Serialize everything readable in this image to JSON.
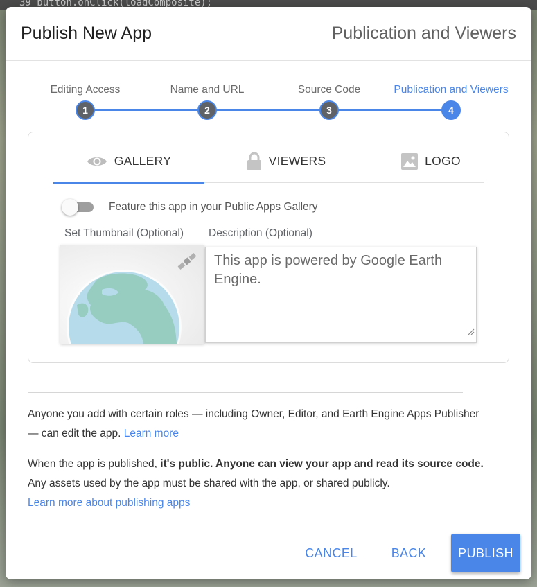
{
  "background": {
    "code_snippet": "39  button.onClick(loadComposite);"
  },
  "dialog": {
    "title": "Publish New App",
    "current_step_title": "Publication and Viewers"
  },
  "stepper": {
    "steps": [
      {
        "label": "Editing Access",
        "number": "1",
        "active": false
      },
      {
        "label": "Name and URL",
        "number": "2",
        "active": false
      },
      {
        "label": "Source Code",
        "number": "3",
        "active": false
      },
      {
        "label": "Publication and Viewers",
        "number": "4",
        "active": true
      }
    ]
  },
  "tabs": [
    {
      "label": "GALLERY",
      "icon": "eye-icon",
      "active": true
    },
    {
      "label": "VIEWERS",
      "icon": "lock-icon",
      "active": false
    },
    {
      "label": "LOGO",
      "icon": "image-icon",
      "active": false
    }
  ],
  "gallery": {
    "feature_toggle_label": "Feature this app in your Public Apps Gallery",
    "feature_toggle_on": false,
    "thumbnail_label": "Set Thumbnail (Optional)",
    "description_label": "Description (Optional)",
    "description_value": "This app is powered by Google Earth Engine."
  },
  "info": {
    "roles_text": "Anyone you add with certain roles — including Owner, Editor, and Earth Engine Apps Publisher — can edit the app.",
    "roles_link": "Learn more",
    "public_prefix": "When the app is published,",
    "public_bold": "it's public. Anyone can view your app and read its source code.",
    "public_suffix": "Any assets used by the app must be shared with the app, or shared publicly.",
    "publish_link": "Learn more about publishing apps"
  },
  "buttons": {
    "cancel": "CANCEL",
    "back": "BACK",
    "publish": "PUBLISH"
  },
  "colors": {
    "accent": "#4a86e8",
    "step_inactive": "#5f6368"
  }
}
